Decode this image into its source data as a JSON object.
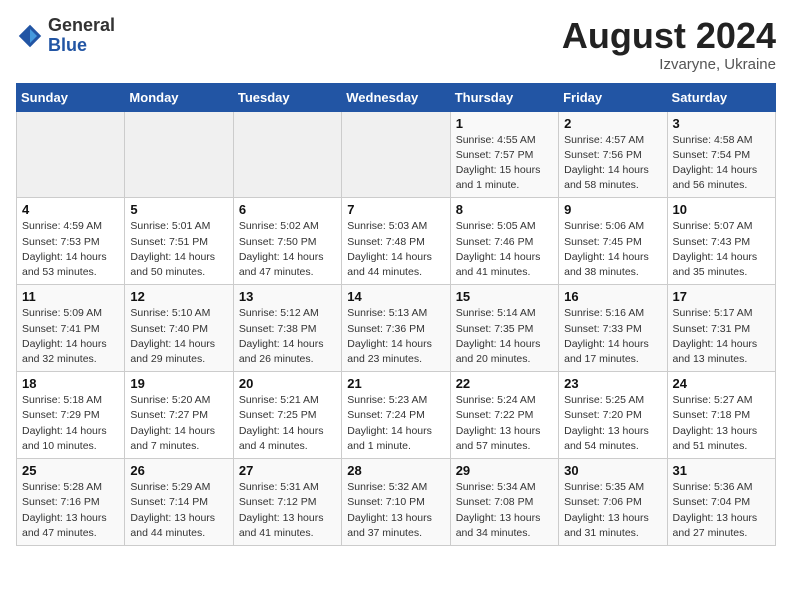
{
  "header": {
    "logo_general": "General",
    "logo_blue": "Blue",
    "month_year": "August 2024",
    "location": "Izvaryne, Ukraine"
  },
  "days_of_week": [
    "Sunday",
    "Monday",
    "Tuesday",
    "Wednesday",
    "Thursday",
    "Friday",
    "Saturday"
  ],
  "weeks": [
    [
      {
        "day": "",
        "info": ""
      },
      {
        "day": "",
        "info": ""
      },
      {
        "day": "",
        "info": ""
      },
      {
        "day": "",
        "info": ""
      },
      {
        "day": "1",
        "info": "Sunrise: 4:55 AM\nSunset: 7:57 PM\nDaylight: 15 hours\nand 1 minute."
      },
      {
        "day": "2",
        "info": "Sunrise: 4:57 AM\nSunset: 7:56 PM\nDaylight: 14 hours\nand 58 minutes."
      },
      {
        "day": "3",
        "info": "Sunrise: 4:58 AM\nSunset: 7:54 PM\nDaylight: 14 hours\nand 56 minutes."
      }
    ],
    [
      {
        "day": "4",
        "info": "Sunrise: 4:59 AM\nSunset: 7:53 PM\nDaylight: 14 hours\nand 53 minutes."
      },
      {
        "day": "5",
        "info": "Sunrise: 5:01 AM\nSunset: 7:51 PM\nDaylight: 14 hours\nand 50 minutes."
      },
      {
        "day": "6",
        "info": "Sunrise: 5:02 AM\nSunset: 7:50 PM\nDaylight: 14 hours\nand 47 minutes."
      },
      {
        "day": "7",
        "info": "Sunrise: 5:03 AM\nSunset: 7:48 PM\nDaylight: 14 hours\nand 44 minutes."
      },
      {
        "day": "8",
        "info": "Sunrise: 5:05 AM\nSunset: 7:46 PM\nDaylight: 14 hours\nand 41 minutes."
      },
      {
        "day": "9",
        "info": "Sunrise: 5:06 AM\nSunset: 7:45 PM\nDaylight: 14 hours\nand 38 minutes."
      },
      {
        "day": "10",
        "info": "Sunrise: 5:07 AM\nSunset: 7:43 PM\nDaylight: 14 hours\nand 35 minutes."
      }
    ],
    [
      {
        "day": "11",
        "info": "Sunrise: 5:09 AM\nSunset: 7:41 PM\nDaylight: 14 hours\nand 32 minutes."
      },
      {
        "day": "12",
        "info": "Sunrise: 5:10 AM\nSunset: 7:40 PM\nDaylight: 14 hours\nand 29 minutes."
      },
      {
        "day": "13",
        "info": "Sunrise: 5:12 AM\nSunset: 7:38 PM\nDaylight: 14 hours\nand 26 minutes."
      },
      {
        "day": "14",
        "info": "Sunrise: 5:13 AM\nSunset: 7:36 PM\nDaylight: 14 hours\nand 23 minutes."
      },
      {
        "day": "15",
        "info": "Sunrise: 5:14 AM\nSunset: 7:35 PM\nDaylight: 14 hours\nand 20 minutes."
      },
      {
        "day": "16",
        "info": "Sunrise: 5:16 AM\nSunset: 7:33 PM\nDaylight: 14 hours\nand 17 minutes."
      },
      {
        "day": "17",
        "info": "Sunrise: 5:17 AM\nSunset: 7:31 PM\nDaylight: 14 hours\nand 13 minutes."
      }
    ],
    [
      {
        "day": "18",
        "info": "Sunrise: 5:18 AM\nSunset: 7:29 PM\nDaylight: 14 hours\nand 10 minutes."
      },
      {
        "day": "19",
        "info": "Sunrise: 5:20 AM\nSunset: 7:27 PM\nDaylight: 14 hours\nand 7 minutes."
      },
      {
        "day": "20",
        "info": "Sunrise: 5:21 AM\nSunset: 7:25 PM\nDaylight: 14 hours\nand 4 minutes."
      },
      {
        "day": "21",
        "info": "Sunrise: 5:23 AM\nSunset: 7:24 PM\nDaylight: 14 hours\nand 1 minute."
      },
      {
        "day": "22",
        "info": "Sunrise: 5:24 AM\nSunset: 7:22 PM\nDaylight: 13 hours\nand 57 minutes."
      },
      {
        "day": "23",
        "info": "Sunrise: 5:25 AM\nSunset: 7:20 PM\nDaylight: 13 hours\nand 54 minutes."
      },
      {
        "day": "24",
        "info": "Sunrise: 5:27 AM\nSunset: 7:18 PM\nDaylight: 13 hours\nand 51 minutes."
      }
    ],
    [
      {
        "day": "25",
        "info": "Sunrise: 5:28 AM\nSunset: 7:16 PM\nDaylight: 13 hours\nand 47 minutes."
      },
      {
        "day": "26",
        "info": "Sunrise: 5:29 AM\nSunset: 7:14 PM\nDaylight: 13 hours\nand 44 minutes."
      },
      {
        "day": "27",
        "info": "Sunrise: 5:31 AM\nSunset: 7:12 PM\nDaylight: 13 hours\nand 41 minutes."
      },
      {
        "day": "28",
        "info": "Sunrise: 5:32 AM\nSunset: 7:10 PM\nDaylight: 13 hours\nand 37 minutes."
      },
      {
        "day": "29",
        "info": "Sunrise: 5:34 AM\nSunset: 7:08 PM\nDaylight: 13 hours\nand 34 minutes."
      },
      {
        "day": "30",
        "info": "Sunrise: 5:35 AM\nSunset: 7:06 PM\nDaylight: 13 hours\nand 31 minutes."
      },
      {
        "day": "31",
        "info": "Sunrise: 5:36 AM\nSunset: 7:04 PM\nDaylight: 13 hours\nand 27 minutes."
      }
    ]
  ]
}
